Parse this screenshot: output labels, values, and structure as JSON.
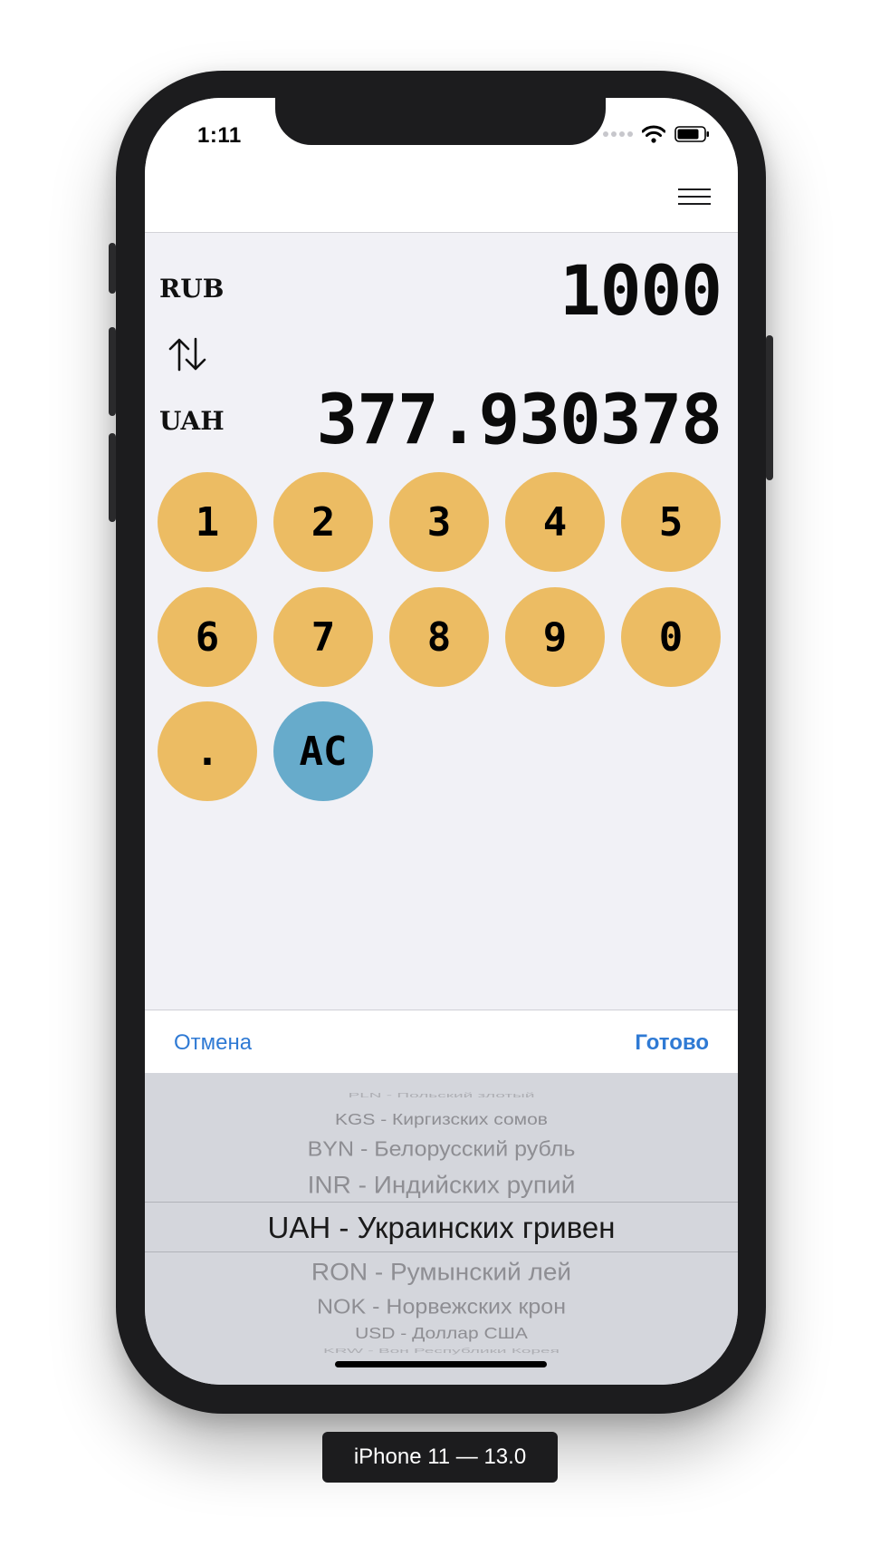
{
  "status_bar": {
    "time": "1:11"
  },
  "converter": {
    "from_currency": "RUB",
    "from_amount": "1000",
    "to_currency": "UAH",
    "to_amount": "377.930378"
  },
  "keypad": {
    "keys": [
      "1",
      "2",
      "3",
      "4",
      "5",
      "6",
      "7",
      "8",
      "9",
      "0",
      ".",
      "AC"
    ]
  },
  "toolbar": {
    "cancel_label": "Отмена",
    "done_label": "Готово"
  },
  "picker": {
    "items": [
      "PLN - Польский злотый",
      "KGS - Киргизских сомов",
      "BYN - Белорусский рубль",
      "INR - Индийских рупий",
      "UAH - Украинских гривен",
      "RON - Румынский лей",
      "NOK - Норвежских крон",
      "USD - Доллар США",
      "KRW - Вон Республики Корея"
    ],
    "selected_index": 4
  },
  "device_label": "iPhone 11 — 13.0",
  "colors": {
    "digit_key": "#ecbc63",
    "clear_key": "#67abcb",
    "toolbar_link": "#2f7ad4",
    "screen_bg": "#f1f1f6"
  },
  "icons": {
    "menu": "hamburger-menu-icon",
    "swap": "swap-arrows-icon",
    "wifi": "wifi-icon",
    "battery": "battery-icon"
  }
}
